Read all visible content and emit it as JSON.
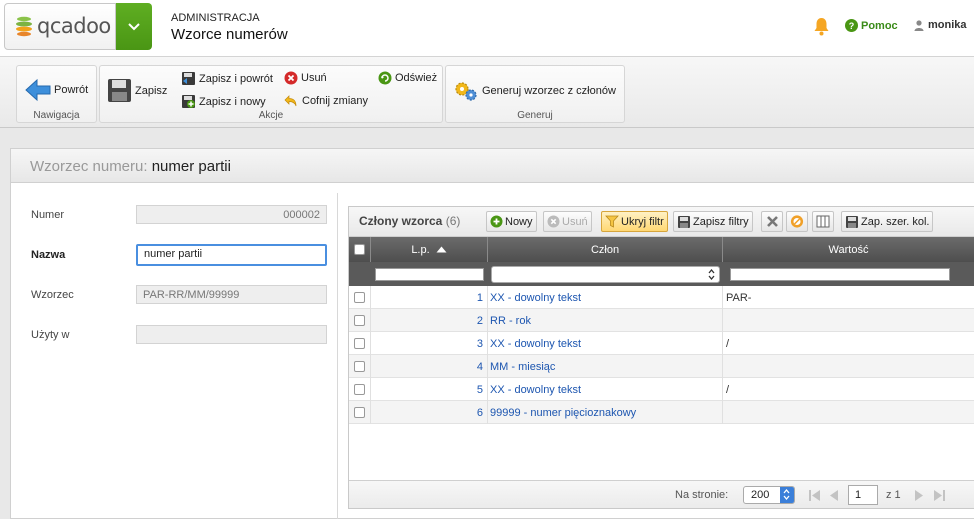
{
  "header": {
    "logo_text": "qcadoo",
    "section": "ADMINISTRACJA",
    "title": "Wzorce numerów",
    "help_label": "Pomoc",
    "user_name": "monika"
  },
  "ribbon": {
    "groups": {
      "navigation": "Nawigacja",
      "actions": "Akcje",
      "generate": "Generuj"
    },
    "back": "Powrót",
    "save": "Zapisz",
    "save_back": "Zapisz i powrót",
    "save_new": "Zapisz i nowy",
    "delete": "Usuń",
    "cancel": "Cofnij zmiany",
    "refresh": "Odśwież",
    "generate": "Generuj wzorzec z członów"
  },
  "form": {
    "title_prefix": "Wzorzec numeru:",
    "title_value": "numer partii",
    "number_label": "Numer",
    "number_value": "000002",
    "name_label": "Nazwa",
    "name_value": "numer partii",
    "pattern_label": "Wzorzec",
    "pattern_value": "PAR-RR/MM/99999",
    "used_label": "Użyty w",
    "used_value": ""
  },
  "grid": {
    "title": "Człony wzorca",
    "count": "(6)",
    "buttons": {
      "new": "Nowy",
      "delete": "Usuń",
      "hide_filter": "Ukryj filtr",
      "save_filters": "Zapisz filtry",
      "save_widths": "Zap. szer. kol."
    },
    "columns": [
      "L.p.",
      "Człon",
      "Wartość"
    ],
    "rows": [
      {
        "lp": "1",
        "member": "XX - dowolny tekst",
        "value": "PAR-"
      },
      {
        "lp": "2",
        "member": "RR - rok",
        "value": ""
      },
      {
        "lp": "3",
        "member": "XX - dowolny tekst",
        "value": "/"
      },
      {
        "lp": "4",
        "member": "MM - miesiąc",
        "value": ""
      },
      {
        "lp": "5",
        "member": "XX - dowolny tekst",
        "value": "/"
      },
      {
        "lp": "6",
        "member": "99999 - numer pięcioznakowy",
        "value": ""
      }
    ],
    "pager": {
      "per_page_label": "Na stronie:",
      "per_page_value": "200",
      "page_value": "1",
      "page_of": "z 1"
    }
  },
  "colors": {
    "brand_green": "#4a9614",
    "link_blue": "#1d56b0",
    "focus_blue": "#4a8fe0"
  },
  "icons": [
    "logo-icon",
    "chevron-down-icon",
    "bell-icon",
    "help-icon",
    "user-icon",
    "back-arrow-icon",
    "floppy-icon",
    "save-back-icon",
    "save-new-icon",
    "delete-icon",
    "undo-icon",
    "refresh-icon",
    "gears-icon",
    "plus-icon",
    "filter-icon",
    "remove-icon",
    "cancel-circle-icon",
    "columns-icon",
    "sort-asc-icon"
  ]
}
